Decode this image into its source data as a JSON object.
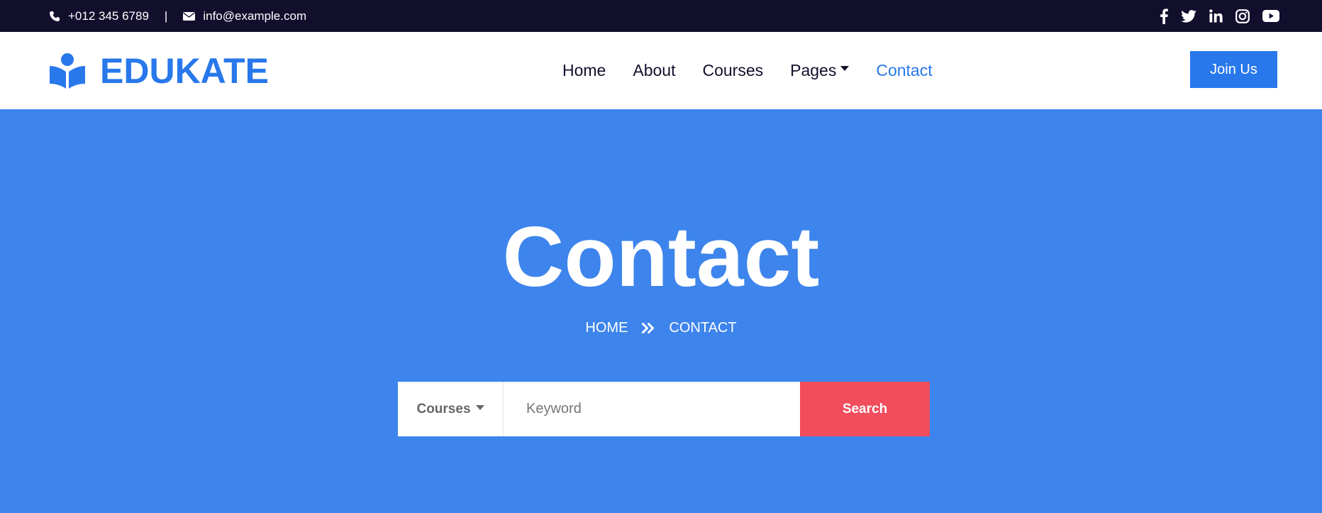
{
  "topbar": {
    "phone": "+012 345 6789",
    "separator": "|",
    "email": "info@example.com",
    "social": [
      "facebook-icon",
      "twitter-icon",
      "linkedin-icon",
      "instagram-icon",
      "youtube-icon"
    ]
  },
  "navbar": {
    "brand": "EDUKATE",
    "links": [
      "Home",
      "About",
      "Courses",
      "Pages",
      "Contact"
    ],
    "active": "Contact",
    "join_label": "Join Us"
  },
  "hero": {
    "title": "Contact",
    "breadcrumb": [
      "HOME",
      "CONTACT"
    ]
  },
  "search": {
    "category": "Courses",
    "placeholder": "Keyword",
    "button_label": "Search"
  },
  "colors": {
    "topbar_bg": "#120f2d",
    "primary": "#2878eb",
    "hero_bg": "#3d84ec",
    "search_button": "#f14d5d"
  }
}
